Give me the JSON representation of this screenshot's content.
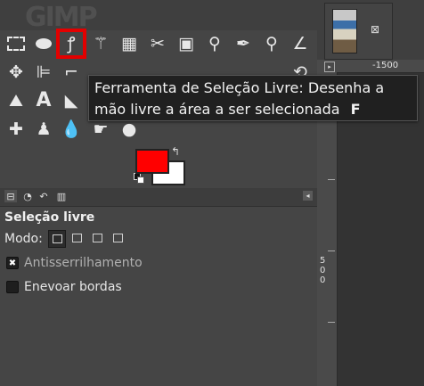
{
  "tooltip": {
    "line1": "Ferramenta de Seleção Livre: Desenha a",
    "line2": "mão livre a área a ser selecionada",
    "shortcut": "F"
  },
  "tool_options": {
    "title": "Seleção livre",
    "mode_label": "Modo:",
    "antialias_label": "Antisserrilhamento",
    "antialias_checked": true,
    "feather_label": "Enevoar bordas",
    "feather_checked": false
  },
  "colors": {
    "foreground": "#ff0000",
    "background": "#ffffff",
    "highlight": "#e30000"
  },
  "rulers": {
    "top_label": "-1500",
    "left_label": "500"
  },
  "icons": {
    "checkmark": "✖",
    "image_close": "⊠",
    "swap": "↰"
  }
}
